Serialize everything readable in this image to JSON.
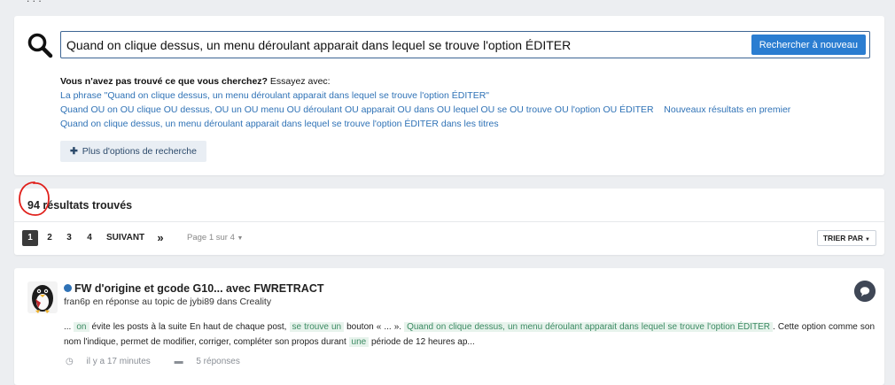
{
  "search": {
    "query": "Quand on clique dessus, un menu déroulant apparait dans lequel se trouve l'option ÉDITER",
    "button_label": "Rechercher à nouveau",
    "suggest_question": "Vous n'avez pas trouvé ce que vous cherchez?",
    "suggest_try": " Essayez avec:",
    "suggestions": [
      "La phrase \"Quand on clique dessus, un menu déroulant apparait dans lequel se trouve l'option ÉDITER\"",
      "Quand OU on OU clique OU dessus, OU un OU menu OU déroulant OU apparait OU dans OU lequel OU se OU trouve OU l'option OU ÉDITER",
      "Nouveaux résultats en premier",
      "Quand on clique dessus, un menu déroulant apparait dans lequel se trouve l'option ÉDITER dans les titres"
    ],
    "more_options_label": "Plus d'options de recherche"
  },
  "results": {
    "count": "94",
    "label": "résultats trouvés",
    "pagination": {
      "pages": [
        "1",
        "2",
        "3",
        "4"
      ],
      "active": "1",
      "next_label": "SUIVANT",
      "last_label": "»",
      "page_of": "Page 1 sur 4"
    },
    "sort_label": "TRIER PAR"
  },
  "post": {
    "title": "FW d'origine et gcode G10... avec FWRETRACT",
    "meta": "fran6p en réponse au topic de jybi89 dans Creality",
    "snippet": {
      "t1": "... ",
      "h1": "on",
      "t2": " évite les posts à la suite En haut de chaque post, ",
      "h2": "se trouve un",
      "t3": " bouton « ... ». ",
      "h3": "Quand on clique dessus, un menu déroulant apparait dans lequel se trouve l'option ÉDITER",
      "t4": ". Cette option comme son nom l'indique, permet de modifier, corriger, compléter son propos durant ",
      "h4": "une",
      "t5": " période de 12 heures ap..."
    },
    "time": "il y a 17 minutes",
    "replies": "5 réponses"
  },
  "colors": {
    "accent": "#2a7dd1",
    "link": "#2f72b6",
    "highlight_bg": "#e7f3ec",
    "highlight_text": "#3b8a62",
    "annotation": "#e0201b"
  }
}
